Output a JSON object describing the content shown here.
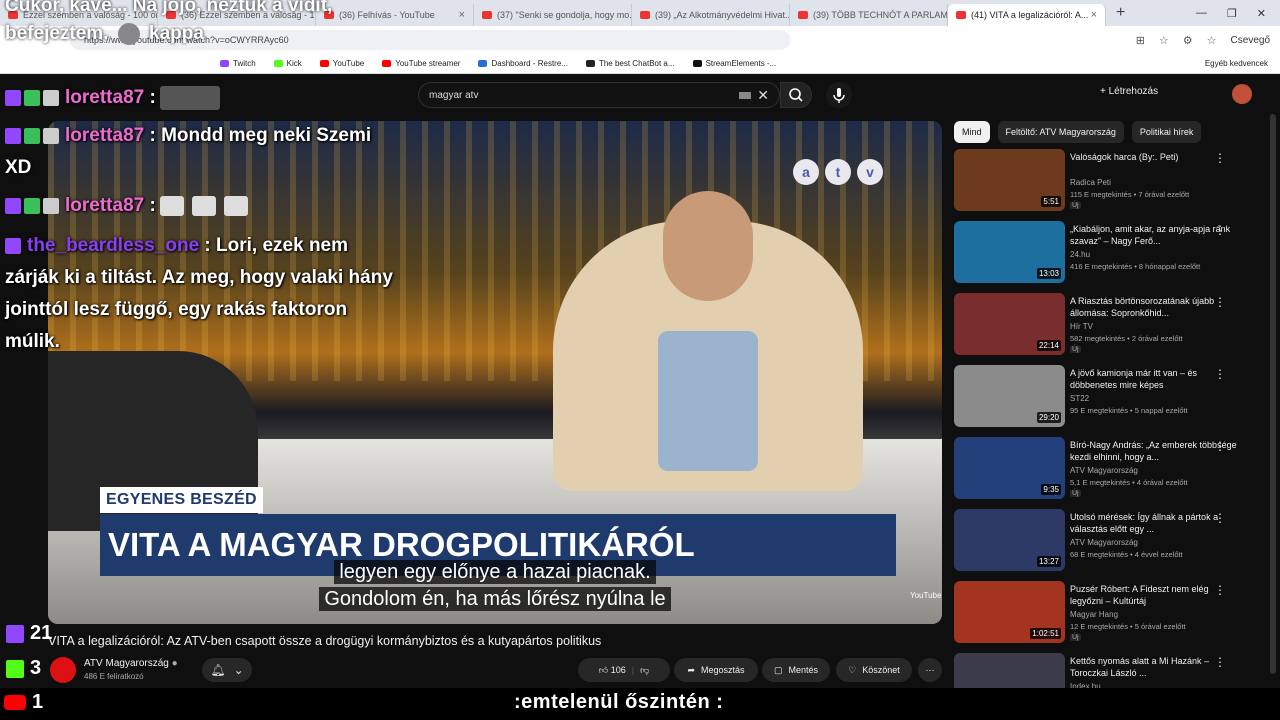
{
  "browser": {
    "tabs": [
      {
        "label": "Ezzel szemben a valóság - 100 ori..."
      },
      {
        "label": "(36) Ezzel szemben a valóság - 10..."
      },
      {
        "label": "(36) Felhívás - YouTube"
      },
      {
        "label": "(37) \"Senki se gondolja, hogy mo..."
      },
      {
        "label": "(39) „Az Alkotmányvédelmi Hivat..."
      },
      {
        "label": "(39) TÖBB TECHNÓT A PARLAMEN..."
      },
      {
        "label": "(41) VITA a legalizációról: A..."
      }
    ],
    "url": "https://www.youtube.com/watch?v=oCWYRRAyc60",
    "profile_label": "Csevegő",
    "bookmarks": [
      "Twitch",
      "Kick",
      "YouTube",
      "YouTube streamer",
      "Dashboard - Restre...",
      "The best ChatBot a...",
      "StreamElements -..."
    ],
    "other_bookmarks": "Egyéb kedvencek"
  },
  "youtube": {
    "search_value": "magyar atv",
    "create_label": "Létrehozás",
    "video": {
      "atv_letters": [
        "a",
        "t",
        "v"
      ],
      "lower_tag": "EGYENES BESZÉD",
      "lower_title": "VITA A MAGYAR DROGPOLITIKÁRÓL",
      "subtitles": [
        "legyen egy előnye a hazai piacnak.",
        "Gondolom én, ha más lőrész nyúlna le"
      ],
      "watermark": "YouTube"
    },
    "title": "VITA a legalizációról: Az ATV-ben csapott össze a drogügyi kormánybiztos és a kutyapártos politikus",
    "channel": {
      "name": "ATV Magyarország",
      "subs": "486 E feliratkozó"
    },
    "likes": "106",
    "share_label": "Megosztás",
    "save_label": "Mentés",
    "thanks_label": "Köszönet",
    "chips": [
      "Mind",
      "Feltöltő: ATV Magyarország",
      "Politikai hírek"
    ],
    "recommendations": [
      {
        "title": "Valóságok harca (By:. Peti)",
        "channel": "Radica Peti",
        "meta": "115 E megtekintés • 7 órával ezelőtt",
        "new": "Új",
        "duration": "5:51",
        "color": "#6d3a1e"
      },
      {
        "title": "„Kiabáljon, amit akar, az anyja-apja ránk szavaz” – Nagy Ferő...",
        "channel": "24.hu",
        "meta": "416 E megtekintés • 8 hónappal ezelőtt",
        "new": "",
        "duration": "13:03",
        "color": "#1d6fa0"
      },
      {
        "title": "A Riasztás börtönsorozatának újabb állomása: Sopronkőhid...",
        "channel": "Hír TV",
        "meta": "582 megtekintés • 2 órával ezelőtt",
        "new": "Új",
        "duration": "22:14",
        "color": "#7a2d2d"
      },
      {
        "title": "A jövő kamionja már itt van – és döbbenetes mire képes",
        "channel": "ST22",
        "meta": "95 E megtekintés • 5 nappal ezelőtt",
        "new": "",
        "duration": "29:20",
        "color": "#8b8b8b"
      },
      {
        "title": "Bíró-Nagy András: „Az emberek többsége kezdi elhinni, hogy a...",
        "channel": "ATV Magyarország",
        "meta": "5,1 E megtekintés • 4 órával ezelőtt",
        "new": "Új",
        "duration": "9:35",
        "color": "#24407a"
      },
      {
        "title": "Utolsó mérések: Így állnak a pártok a választás előtt egy ...",
        "channel": "ATV Magyarország",
        "meta": "68 E megtekintés • 4 évvel ezelőtt",
        "new": "",
        "duration": "13:27",
        "color": "#2d3a66"
      },
      {
        "title": "Puzsér Róbert: A Fideszt nem elég legyőzni – Kultúrtáj",
        "channel": "Magyar Hang",
        "meta": "12 E megtekintés • 5 órával ezelőtt",
        "new": "Új",
        "duration": "1:02:51",
        "color": "#a3341f"
      },
      {
        "title": "Kettős nyomás alatt a Mi Hazánk – Toroczkai László ...",
        "channel": "Index.hu",
        "meta": "",
        "new": "",
        "duration": "",
        "color": "#3b3b4a"
      }
    ]
  },
  "overlay": {
    "top_text": [
      "Cukor, kávé... Na jójó, néztük a vidit,",
      "befejeztem.",
      "kappa"
    ],
    "chat": [
      {
        "user": "loretta87",
        "text": ":",
        "emotes": 1
      },
      {
        "user": "loretta87",
        "text": ": Mondd meg neki Szemi",
        "cont": "XD"
      },
      {
        "user": "loretta87",
        "text": ":",
        "emotes": 3
      },
      {
        "user": "the_beardless_one",
        "text": ": Lori, ezek nem",
        "lines": [
          "zárják ki a tiltást. Az meg, hogy valaki hány",
          "jointtól lesz függő, egy rakás faktoron",
          "múlik."
        ]
      }
    ],
    "twitch_count": "21",
    "kick_count": "3",
    "youtube_count": "1",
    "ticker": ":emtelenül őszintén :"
  }
}
